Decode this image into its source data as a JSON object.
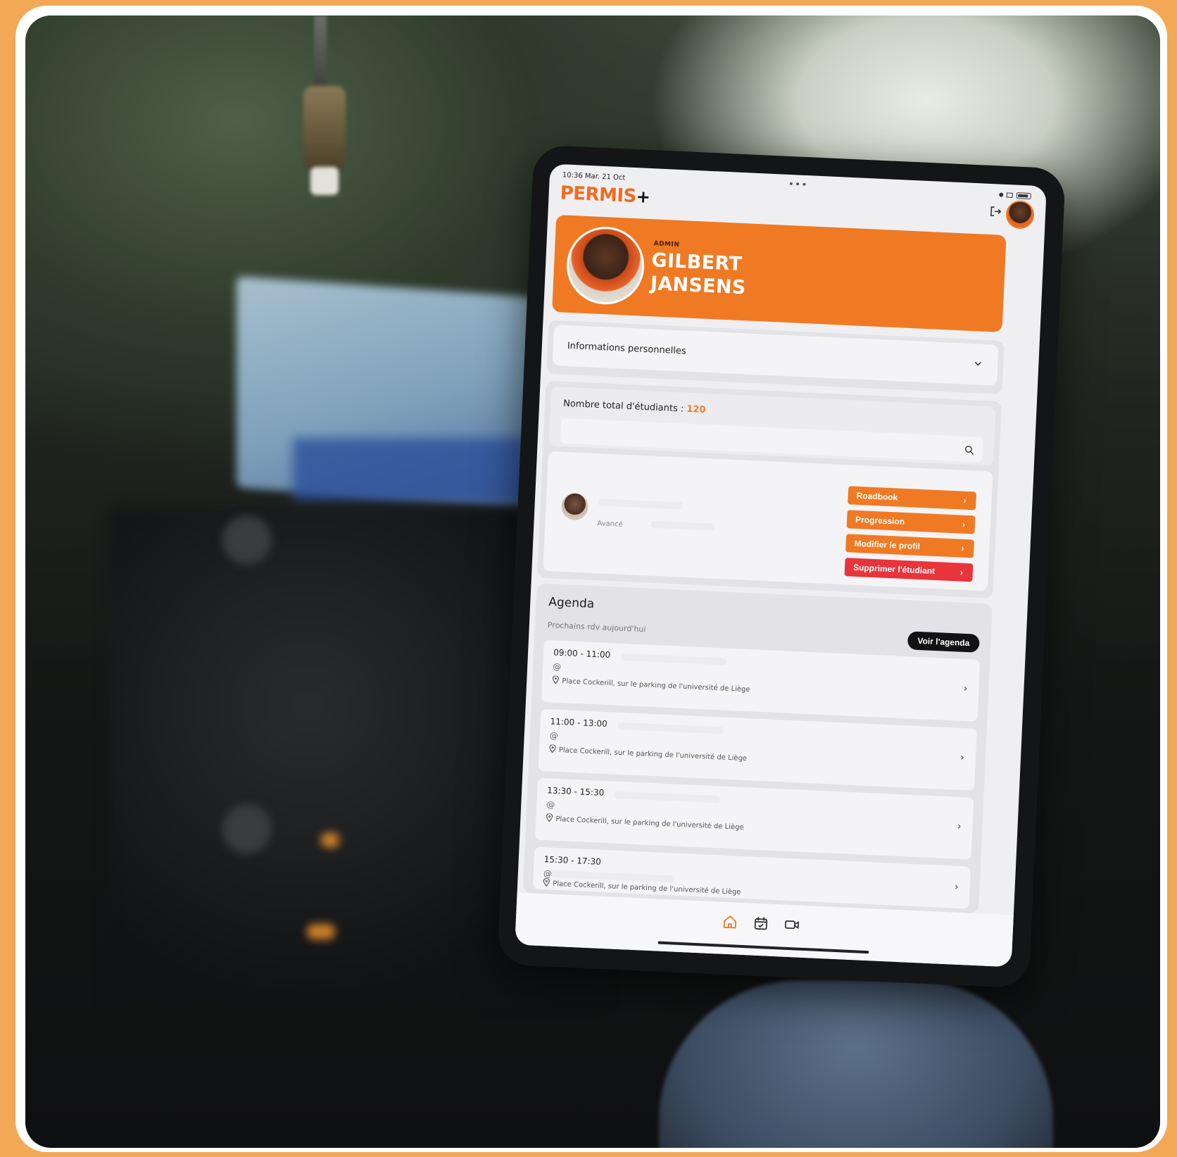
{
  "status_bar": {
    "time_date": "10:36  Mar. 21 Oct",
    "dots": "•••"
  },
  "app": {
    "logo_text": "PERMIS",
    "logo_plus": "+",
    "accent_color": "#f07a24",
    "danger_color": "#e8343a"
  },
  "profile": {
    "role": "ADMIN",
    "first_name": "GILBERT",
    "last_name": "JANSENS"
  },
  "accordion": {
    "label": "Informations personnelles"
  },
  "students": {
    "count_label": "Nombre total d'étudiants :",
    "count_value": "120",
    "search_placeholder": "",
    "student": {
      "level": "Avancé"
    },
    "actions": {
      "roadbook": "Roadbook",
      "progression": "Progression",
      "edit_profile": "Modifier le profil",
      "delete_student": "Supprimer l'étudiant"
    }
  },
  "agenda": {
    "title": "Agenda",
    "subtitle": "Prochains rdv aujourd'hui",
    "view_button": "Voir l'agenda",
    "slots": [
      {
        "time": "09:00 - 11:00",
        "at": "@",
        "place": "Place Cockerill, sur le parking de l'université de Liège"
      },
      {
        "time": "11:00 - 13:00",
        "at": "@",
        "place": "Place Cockerill, sur le parking de l'université de Liège"
      },
      {
        "time": "13:30 - 15:30",
        "at": "@",
        "place": "Place Cockerill, sur le parking de l'université de Liège"
      },
      {
        "time": "15:30 - 17:30",
        "at": "@",
        "place": "Place Cockerill, sur le parking de l'université de Liège"
      }
    ]
  },
  "icons": {
    "logout": "logout-icon",
    "chevron": "›",
    "tabs": [
      "home-icon",
      "calendar-check-icon",
      "video-camera-icon"
    ]
  }
}
